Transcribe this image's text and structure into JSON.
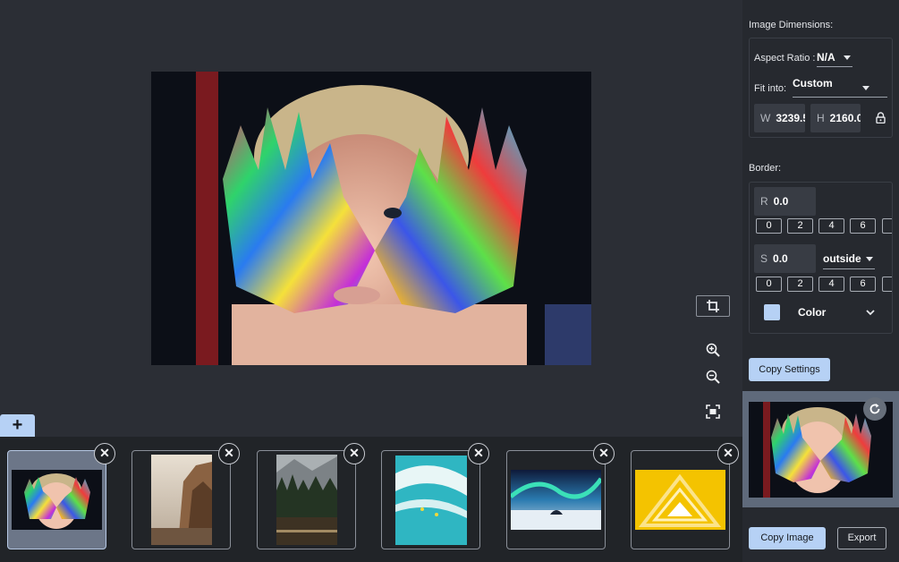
{
  "toolbar": {
    "crop_icon": "crop-icon",
    "zoom_in_icon": "zoom-in-icon",
    "zoom_out_icon": "zoom-out-icon",
    "fit_icon": "fit-screen-icon",
    "add_label": "+"
  },
  "thumbnails": [
    {
      "name": "painted-hands",
      "close": "✕"
    },
    {
      "name": "rock-formation",
      "close": "✕"
    },
    {
      "name": "forest-lake",
      "close": "✕"
    },
    {
      "name": "surfers-wave",
      "close": "✕"
    },
    {
      "name": "aurora-cabin",
      "close": "✕"
    },
    {
      "name": "yellow-triangles",
      "close": "✕"
    }
  ],
  "sidebar": {
    "dimensions_title": "Image Dimensions:",
    "aspect_label": "Aspect Ratio :",
    "aspect_value": "N/A",
    "fit_label": "Fit into:",
    "fit_value": "Custom",
    "width_key": "W",
    "width_value": "3239.5",
    "height_key": "H",
    "height_value": "2160.0",
    "lock_icon": "lock-icon",
    "border_title": "Border:",
    "radius_key": "R",
    "radius_value": "0.0",
    "radius_presets": [
      "0",
      "2",
      "4",
      "6"
    ],
    "size_key": "S",
    "size_value": "0.0",
    "size_position": "outside",
    "size_presets": [
      "0",
      "2",
      "4",
      "6"
    ],
    "color_label": "Color",
    "color_value": "#b6d1f5",
    "copy_settings": "Copy Settings",
    "refresh_icon": "refresh-icon",
    "copy_image": "Copy Image",
    "export": "Export"
  }
}
